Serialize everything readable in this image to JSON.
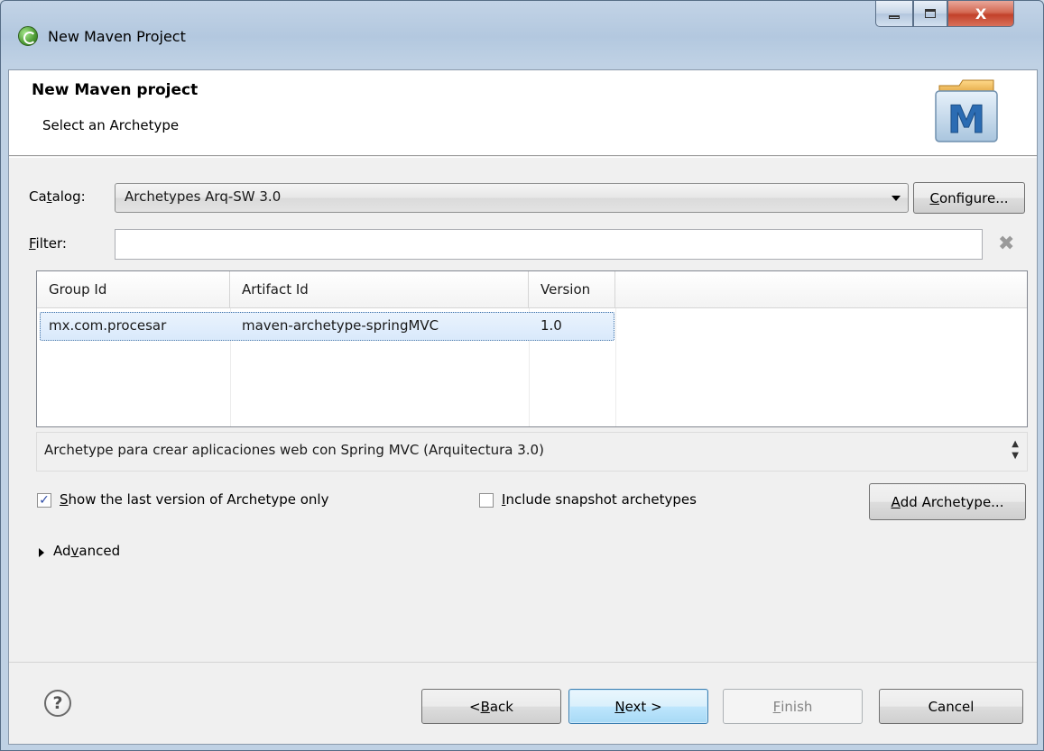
{
  "window": {
    "title": "New Maven Project",
    "close_glyph": "X"
  },
  "header": {
    "title": "New Maven project",
    "subtitle": "Select an Archetype",
    "logo_letter": "M"
  },
  "catalog": {
    "label_pre": "Ca",
    "label_key": "t",
    "label_post": "alog:",
    "selected": "Archetypes Arq-SW 3.0",
    "configure_key": "C",
    "configure_rest": "onfigure..."
  },
  "filter": {
    "label_key": "F",
    "label_rest": "ilter:",
    "value": ""
  },
  "table": {
    "columns": [
      "Group Id",
      "Artifact Id",
      "Version"
    ],
    "rows": [
      {
        "group_id": "mx.com.procesar",
        "artifact_id": "maven-archetype-springMVC",
        "version": "1.0"
      }
    ]
  },
  "description": "Archetype para crear aplicaciones web con Spring MVC (Arquitectura 3.0)",
  "options": {
    "show_last_key": "S",
    "show_last_rest": "how the last version of Archetype only",
    "show_last_checked": true,
    "include_snapshot_key": "I",
    "include_snapshot_rest": "nclude snapshot archetypes",
    "include_snapshot_checked": false,
    "add_archetype_key": "A",
    "add_archetype_rest": "dd Archetype..."
  },
  "advanced": {
    "label_pre": "Ad",
    "label_key": "v",
    "label_post": "anced"
  },
  "footer": {
    "help_glyph": "?",
    "back_pre": "< ",
    "back_key": "B",
    "back_rest": "ack",
    "next_key": "N",
    "next_rest": "ext >",
    "finish_key": "F",
    "finish_rest": "inish",
    "cancel": "Cancel"
  },
  "colors": {
    "accent": "#3c7fb1",
    "selection": "#d9e9fb",
    "close_red": "#c2412a"
  }
}
